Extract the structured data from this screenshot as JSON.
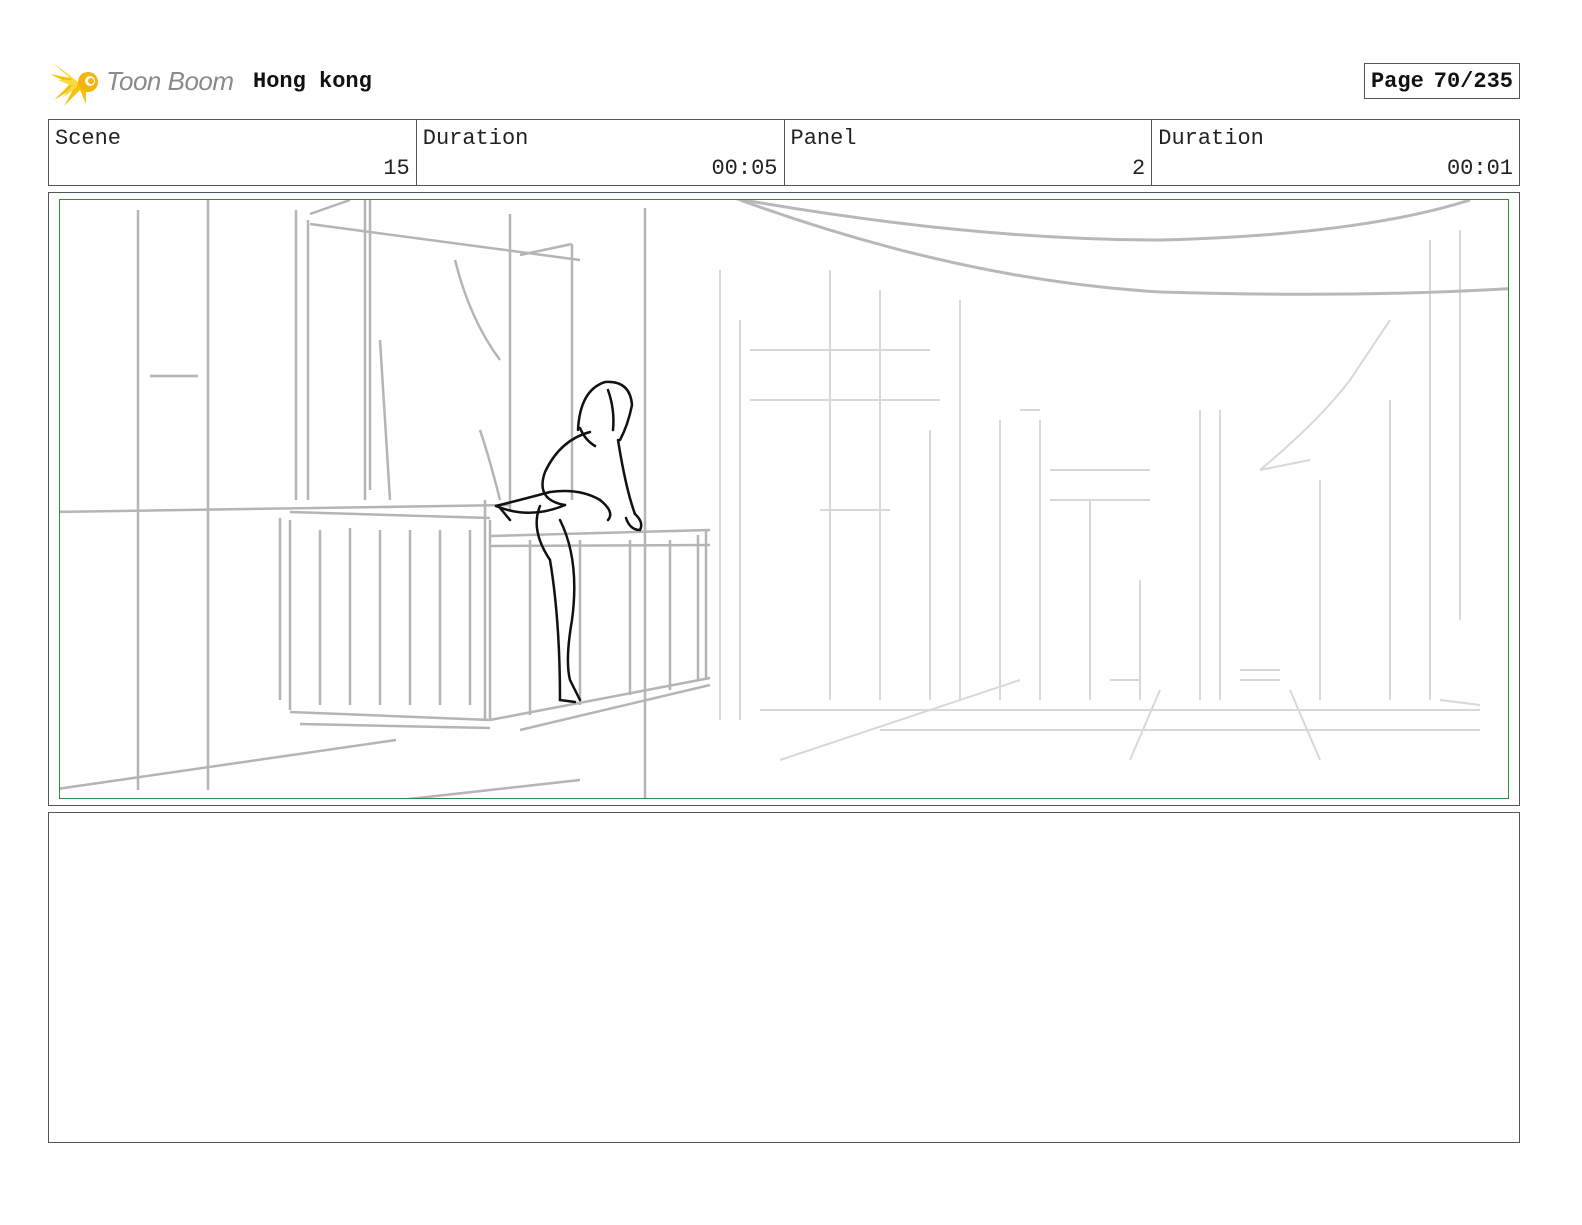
{
  "header": {
    "logo_text": "Toon Boom",
    "project_title": "Hong kong",
    "page_label": "Page",
    "page_value": "70/235"
  },
  "info": {
    "scene_label": "Scene",
    "scene_value": "15",
    "scene_duration_label": "Duration",
    "scene_duration_value": "00:05",
    "panel_label": "Panel",
    "panel_value": "2",
    "panel_duration_label": "Duration",
    "panel_duration_value": "00:01"
  },
  "panel": {
    "image_name": "storyboard-sketch",
    "safe_frame_color": "#2e8b3a"
  },
  "notes": {}
}
